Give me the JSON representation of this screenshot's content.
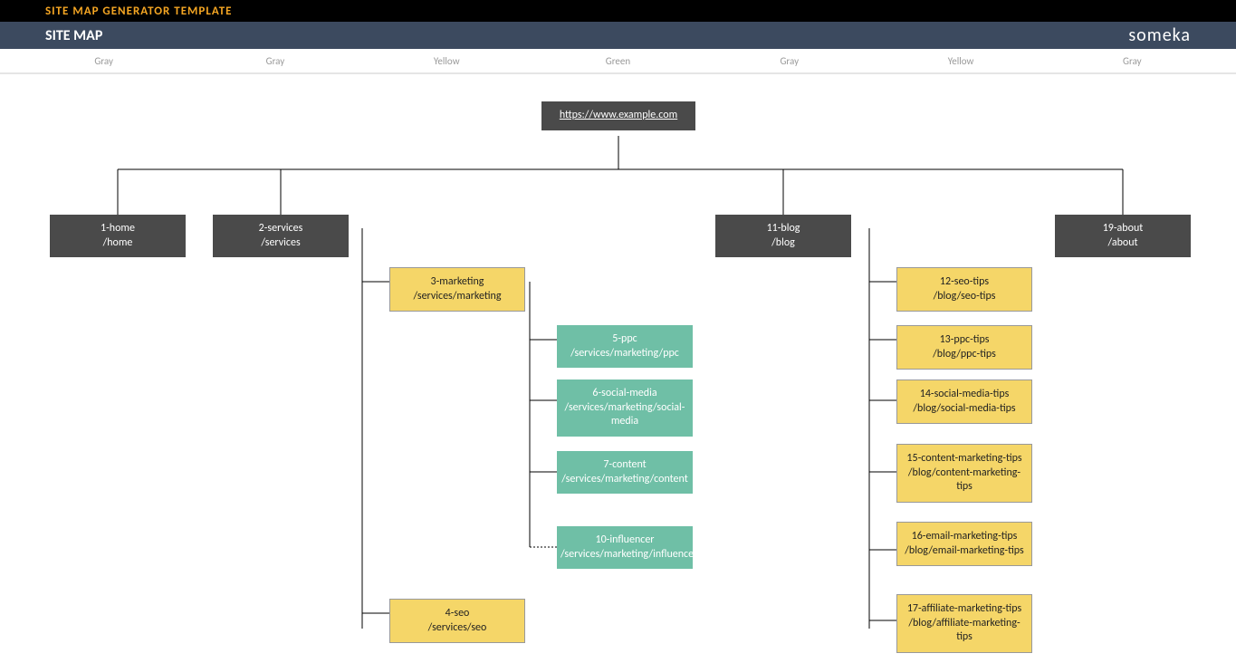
{
  "topbar": {
    "title": "SITE MAP GENERATOR TEMPLATE"
  },
  "subbar": {
    "title": "SITE MAP",
    "brand": "someka"
  },
  "columns": [
    "Gray",
    "Gray",
    "Yellow",
    "Green",
    "Gray",
    "Yellow",
    "Gray"
  ],
  "root": {
    "label": "https://www.example.com"
  },
  "nodes": {
    "home": {
      "name": "1-home",
      "path": "/home"
    },
    "services": {
      "name": "2-services",
      "path": "/services"
    },
    "marketing": {
      "name": "3-marketing",
      "path": "/services/marketing"
    },
    "seo": {
      "name": "4-seo",
      "path": "/services/seo"
    },
    "ppc": {
      "name": "5-ppc",
      "path": "/services/marketing/ppc"
    },
    "social": {
      "name": "6-social-media",
      "path": "/services/marketing/social-media"
    },
    "content": {
      "name": "7-content",
      "path": "/services/marketing/content"
    },
    "influencer": {
      "name": "10-influencer",
      "path": "/services/marketing/influencer"
    },
    "blog": {
      "name": "11-blog",
      "path": "/blog"
    },
    "seotips": {
      "name": "12-seo-tips",
      "path": "/blog/seo-tips"
    },
    "ppctips": {
      "name": "13-ppc-tips",
      "path": "/blog/ppc-tips"
    },
    "smtips": {
      "name": "14-social-media-tips",
      "path": "/blog/social-media-tips"
    },
    "cmtips": {
      "name": "15-content-marketing-tips",
      "path": "/blog/content-marketing-tips"
    },
    "emtips": {
      "name": "16-email-marketing-tips",
      "path": "/blog/email-marketing-tips"
    },
    "amtips": {
      "name": "17-affiliate-marketing-tips",
      "path": "/blog/affiliate-marketing-tips"
    },
    "about": {
      "name": "19-about",
      "path": "/about"
    }
  }
}
